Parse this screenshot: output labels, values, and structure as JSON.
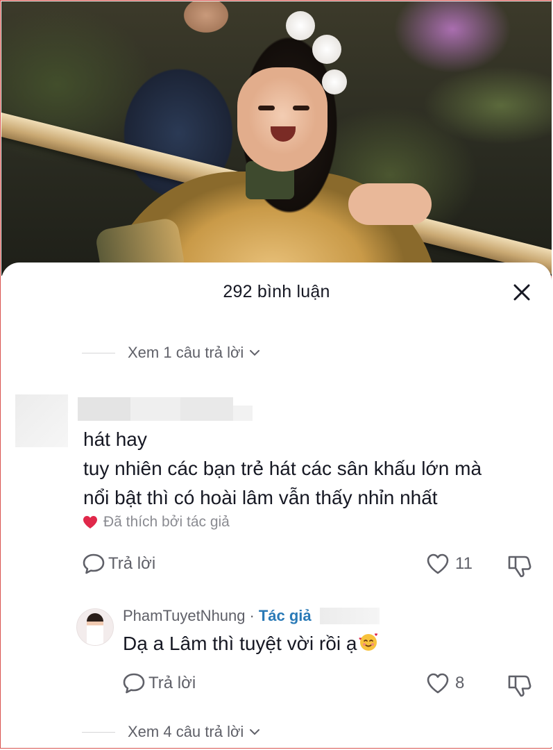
{
  "sheet": {
    "title": "292 bình luận",
    "view_replies_top": "Xem 1 câu trả lời",
    "view_replies_bottom": "Xem 4 câu trả lời"
  },
  "comment": {
    "text": "hát hay\ntuy nhiên các bạn trẻ hát các sân khấu lớn mà\nnổi bật thì có hoài lâm vẫn thấy nhỉn nhất",
    "liked_by_author": "Đã thích bởi tác giả",
    "reply_label": "Trả lời",
    "like_count": "11"
  },
  "reply": {
    "username": "PhamTuyetNhung",
    "separator": "·",
    "author_badge": "Tác giả",
    "text": "Dạ a Lâm thì tuyệt vời rồi ạ",
    "emoji": "smiling-face-with-hearts",
    "reply_label": "Trả lời",
    "like_count": "8"
  },
  "colors": {
    "text_primary": "#161823",
    "text_secondary": "#5f6068",
    "author_blue": "#2a7ab7",
    "liked_heart": "#e0284a"
  }
}
